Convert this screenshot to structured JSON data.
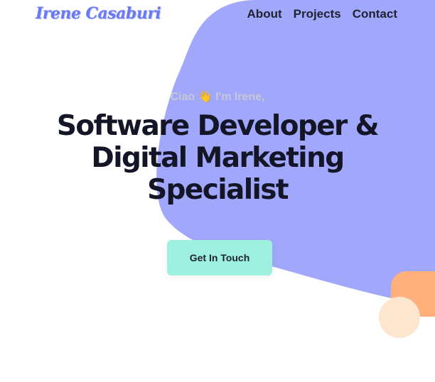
{
  "brand": {
    "logo_text": "Irene Casaburi",
    "logo_color": "#6a78f2"
  },
  "nav": {
    "items": [
      {
        "label": "About"
      },
      {
        "label": "Projects"
      },
      {
        "label": "Contact"
      }
    ]
  },
  "hero": {
    "greeting": "Ciao 👋 I'm Irene,",
    "headline_lines": [
      "Software Developer &",
      "Digital Marketing",
      "Specialist"
    ],
    "cta_label": "Get In Touch"
  },
  "colors": {
    "blob": "#a1a8fc",
    "cta_background": "#9ef0df",
    "orange_accent": "#ffb07c",
    "peach_accent": "#fde6cf",
    "headline_text": "#141526",
    "greeting_text": "#c4c7d6"
  }
}
